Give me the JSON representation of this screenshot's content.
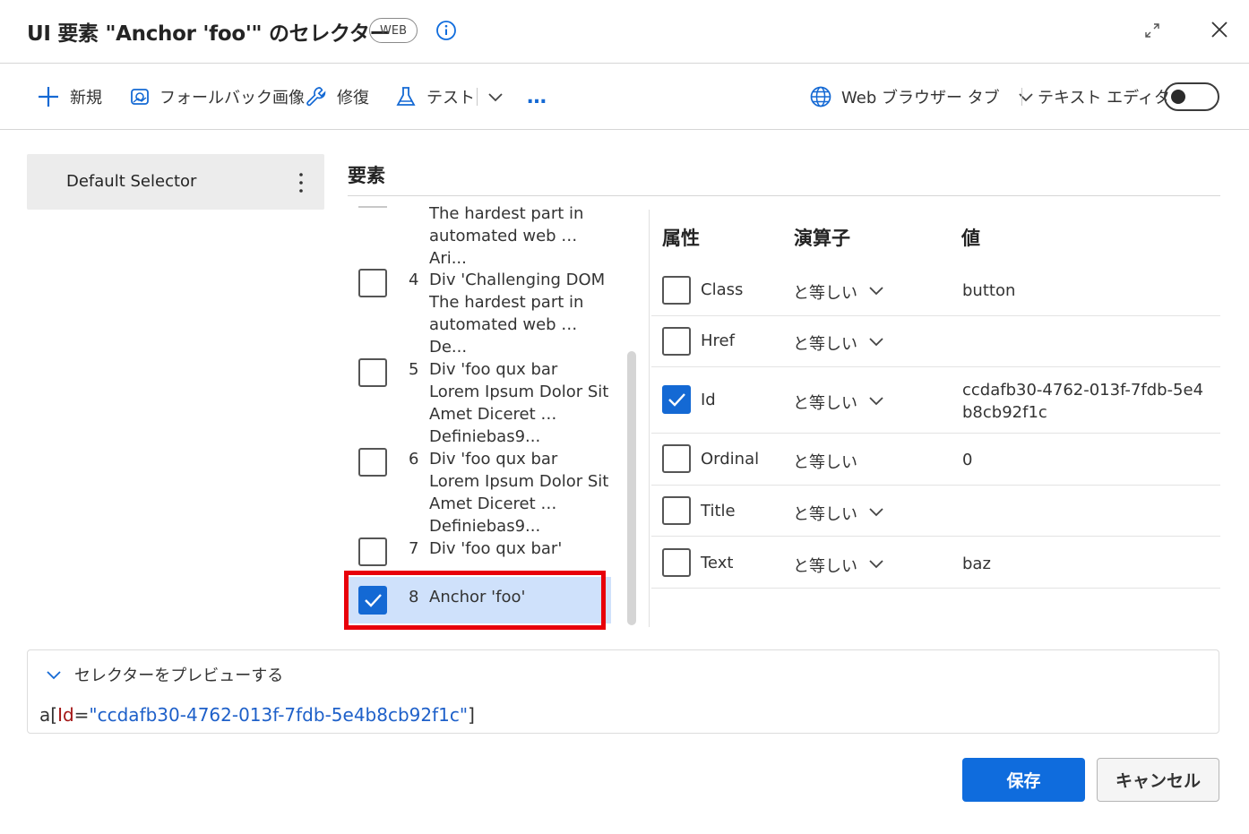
{
  "dialog": {
    "title": "UI 要素 \"Anchor 'foo'\" のセレクター",
    "badge": "WEB"
  },
  "toolbar": {
    "new_label": "新規",
    "fallback_label": "フォールバック画像",
    "repair_label": "修復",
    "test_label": "テスト",
    "more_label": "…",
    "browser_tab_label": "Web ブラウザー タブ",
    "text_editor_label": "テキスト エディター",
    "text_editor_on": false
  },
  "selectors": {
    "items": [
      {
        "label": "Default Selector"
      }
    ]
  },
  "elements": {
    "title": "要素",
    "items": [
      {
        "num": "",
        "text": "The hardest part in automated web … Ari...",
        "checked": false
      },
      {
        "num": "4",
        "text": "Div 'Challenging DOM The hardest part in automated web … De...",
        "checked": false
      },
      {
        "num": "5",
        "text": "Div 'foo qux bar Lorem Ipsum Dolor Sit Amet Diceret … Definiebas9...",
        "checked": false
      },
      {
        "num": "6",
        "text": "Div 'foo qux bar Lorem Ipsum Dolor Sit Amet Diceret … Definiebas9...",
        "checked": false
      },
      {
        "num": "7",
        "text": "Div 'foo qux bar'",
        "checked": false
      },
      {
        "num": "8",
        "text": "Anchor 'foo'",
        "checked": true,
        "selected": true
      }
    ]
  },
  "attributes": {
    "headers": {
      "attribute": "属性",
      "operator": "演算子",
      "value": "値"
    },
    "rows": [
      {
        "name": "Class",
        "operator": "と等しい",
        "value": "button",
        "checked": false
      },
      {
        "name": "Href",
        "operator": "と等しい",
        "value": "",
        "checked": false
      },
      {
        "name": "Id",
        "operator": "と等しい",
        "value": "ccdafb30-4762-013f-7fdb-5e4b8cb92f1c",
        "checked": true
      },
      {
        "name": "Ordinal",
        "operator": "と等しい",
        "value": "0",
        "checked": false
      },
      {
        "name": "Title",
        "operator": "と等しい",
        "value": "",
        "checked": false
      },
      {
        "name": "Text",
        "operator": "と等しい",
        "value": "baz",
        "checked": false
      }
    ]
  },
  "preview": {
    "toggle_label": "セレクターをプレビューする",
    "code_prefix": "a[",
    "code_attr": "Id",
    "code_eq": "=",
    "code_value": "\"ccdafb30-4762-013f-7fdb-5e4b8cb92f1c\"",
    "code_suffix": "]"
  },
  "footer": {
    "save_label": "保存",
    "cancel_label": "キャンセル"
  },
  "colors": {
    "accent": "#0f6cdd",
    "selected_row": "#cfe1fb",
    "highlight_frame": "#e8000a"
  }
}
